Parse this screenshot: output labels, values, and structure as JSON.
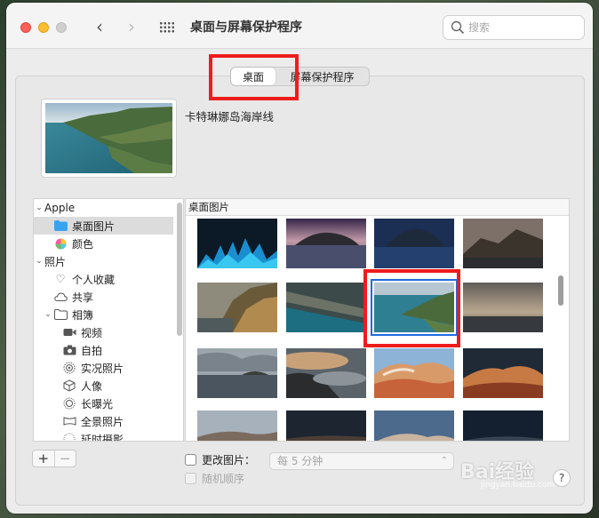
{
  "window": {
    "title": "桌面与屏幕保护程序",
    "search_placeholder": "搜索"
  },
  "tabs": [
    {
      "label": "桌面",
      "selected": true
    },
    {
      "label": "屏幕保护程序",
      "selected": false
    }
  ],
  "current": {
    "name": "卡特琳娜岛海岸线"
  },
  "sidebar": {
    "items": [
      {
        "label": "Apple",
        "icon": "chevron-down-icon"
      },
      {
        "label": "桌面图片",
        "icon": "folder-icon",
        "selected": true
      },
      {
        "label": "颜色",
        "icon": "color-wheel-icon"
      },
      {
        "label": "照片",
        "icon": "chevron-down-icon"
      },
      {
        "label": "个人收藏",
        "icon": "heart-icon"
      },
      {
        "label": "共享",
        "icon": "cloud-icon"
      },
      {
        "label": "相簿",
        "icon": "folder-icon"
      },
      {
        "label": "视频",
        "icon": "video-icon"
      },
      {
        "label": "自拍",
        "icon": "camera-icon"
      },
      {
        "label": "实况照片",
        "icon": "live-photo-icon"
      },
      {
        "label": "人像",
        "icon": "cube-icon"
      },
      {
        "label": "长曝光",
        "icon": "long-exposure-icon"
      },
      {
        "label": "全景照片",
        "icon": "panorama-icon"
      },
      {
        "label": "延时摄影",
        "icon": "timelapse-icon"
      }
    ]
  },
  "content": {
    "header": "桌面图片"
  },
  "controls": {
    "add": "+",
    "remove": "−",
    "change_picture": "更改图片：",
    "interval": "每 5 分钟",
    "random_order": "随机顺序",
    "help": "?"
  },
  "watermark": {
    "brand": "Bai经验",
    "url": "jingyan.baidu.com"
  },
  "colors": {
    "highlight": "#ee1c1c",
    "selection": "#1f6ce0",
    "folder": "#3aa3f0"
  }
}
